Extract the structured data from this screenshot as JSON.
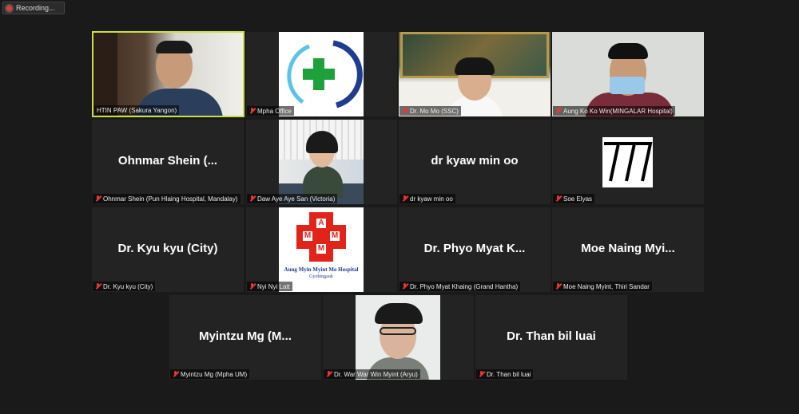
{
  "recording": {
    "label": "Recording..."
  },
  "participants": [
    {
      "display": "",
      "label": "HTIN PAW (Sakura Yangon)",
      "muted": false
    },
    {
      "display": "",
      "label": "Mpha Office",
      "muted": true
    },
    {
      "display": "",
      "label": "Dr. Mo Mo (SSC)",
      "muted": true
    },
    {
      "display": "",
      "label": "Aung Ko Ko Win(MINGALAR Hospital)",
      "muted": true
    },
    {
      "display": "Ohnmar Shein (...",
      "label": "Ohnmar Shein (Pun Hlaing Hospital, Mandalay)",
      "muted": true
    },
    {
      "display": "",
      "label": "Daw Aye Aye San (Victoria)",
      "muted": true
    },
    {
      "display": "dr kyaw min oo",
      "label": "dr kyaw min oo",
      "muted": true
    },
    {
      "display": "",
      "label": "Soe Elyas",
      "muted": true
    },
    {
      "display": "Dr. Kyu kyu (City)",
      "label": "Dr. Kyu kyu (City)",
      "muted": true
    },
    {
      "display": "",
      "label": "Nyi Nyi Latt",
      "muted": true
    },
    {
      "display": "Dr. Phyo Myat K...",
      "label": "Dr. Phyo Myat Khaing (Grand Hantha)",
      "muted": true
    },
    {
      "display": "Moe Naing Myi...",
      "label": "Moe Naing Myint, Thiri Sandar",
      "muted": true
    },
    {
      "display": "Myintzu Mg (M...",
      "label": "Myintzu Mg (Mpha UM)",
      "muted": true
    },
    {
      "display": "",
      "label": "Dr. War War Win Myint (Aryu)",
      "muted": true
    },
    {
      "display": "Dr. Than bil luai",
      "label": "Dr. Than bil luai",
      "muted": true
    }
  ],
  "logos": {
    "hospital_line1": "Aung Myin Myint Mo Hospital",
    "hospital_line2": "Gyobingauk",
    "hospital_letters": [
      "A",
      "M",
      "M",
      "M"
    ],
    "soe_logo": "777"
  },
  "colors": {
    "active_speaker": "#c8e04a",
    "muted": "#e33333",
    "tile_bg": "#232323"
  }
}
